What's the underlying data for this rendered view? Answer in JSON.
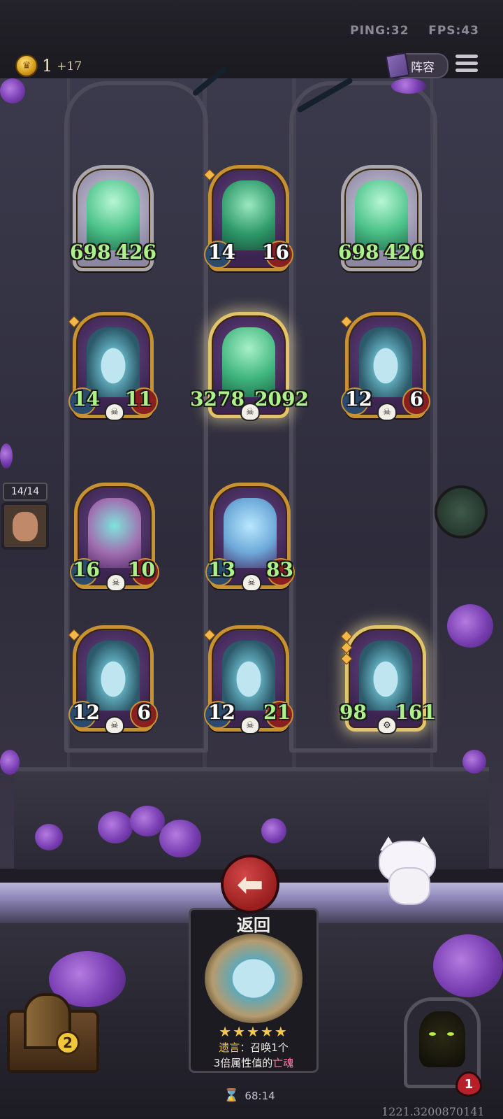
{
  "hud": {
    "ping_label": "PING:32",
    "fps_label": "FPS:43",
    "gold": "1",
    "gold_income": "+17",
    "lineup_label": "阵容"
  },
  "board": {
    "cards": [
      {
        "id": "bride-left",
        "atk": "698",
        "hp": "426",
        "type": "bride",
        "frame": "silver"
      },
      {
        "id": "keeper-top",
        "atk": "14",
        "hp": "16",
        "type": "keeper",
        "frame": "gold"
      },
      {
        "id": "bride-right",
        "atk": "698",
        "hp": "426",
        "type": "bride",
        "frame": "silver"
      },
      {
        "id": "bottle-r2-left",
        "atk": "14",
        "hp": "11",
        "type": "bottle",
        "frame": "gold"
      },
      {
        "id": "bride-center",
        "atk": "3278",
        "hp": "2092",
        "type": "bride",
        "frame": "golden"
      },
      {
        "id": "bottle-r2-right",
        "atk": "12",
        "hp": "6",
        "type": "bottle",
        "frame": "gold"
      },
      {
        "id": "witch",
        "atk": "16",
        "hp": "10",
        "type": "witch",
        "frame": "gold"
      },
      {
        "id": "hooded-ghost",
        "atk": "13",
        "hp": "83",
        "type": "hood",
        "frame": "gold"
      },
      {
        "id": "bottle-r4-left",
        "atk": "12",
        "hp": "6",
        "type": "bottle",
        "frame": "gold"
      },
      {
        "id": "bottle-r4-center",
        "atk": "12",
        "hp": "21",
        "type": "bottle",
        "frame": "gold"
      },
      {
        "id": "bottle-r4-right",
        "atk": "98",
        "hp": "161",
        "type": "bottle",
        "frame": "golden"
      }
    ],
    "enemy_count": "14/14"
  },
  "detail": {
    "back_label": "返回",
    "stars": "★★★★★",
    "ability_prefix": "遗言",
    "ability_line1": "：召唤1个",
    "ability_line2_a": "3倍属性值的",
    "ability_line2_b": "亡魂"
  },
  "footer": {
    "timer": "68:14",
    "chest_count": "2",
    "lives": "1",
    "coords": "1221.3200870141"
  },
  "icons": {
    "coin": "coin-icon",
    "lineup": "book-icon",
    "menu": "hamburger-menu-icon",
    "back": "arrow-left-icon",
    "skull": "skull-icon",
    "hourglass": "hourglass-icon",
    "heart": "heart-icon"
  },
  "colors": {
    "frame_gold": "#c89233",
    "stat_green": "#aef08a",
    "back_red": "#b5202a",
    "accent_yellow": "#f1c44e"
  }
}
